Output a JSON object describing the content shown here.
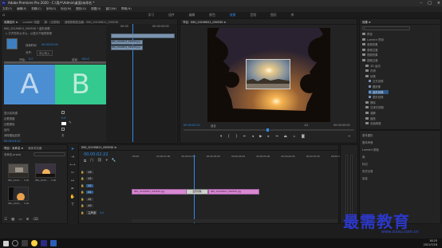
{
  "window": {
    "title": "Adobe Premiere Pro 2020 - C:\\用户\\Admin\\桌面\\未命名 *"
  },
  "menu": [
    "文件(F)",
    "编辑(E)",
    "剪辑(C)",
    "序列(S)",
    "标记(M)",
    "图形(G)",
    "视图(V)",
    "窗口(W)",
    "帮助(H)"
  ],
  "workspaces": [
    "学习",
    "组件",
    "编辑",
    "颜色",
    "效果",
    "音频",
    "图形",
    "库"
  ],
  "workspace_active": "效果",
  "effect_controls": {
    "tabs": [
      "效果控件 ≡",
      "Lumetri 范围",
      "源：(无剪辑)",
      "音频剪辑混合器：IMG_20190811_090530"
    ],
    "header": "IMG_20190811_090530 * 盒形划像",
    "desc": "▷ 打开形状从中心，以显示下面的剪辑",
    "duration_label": "持续时间",
    "duration": "00:00:01:00",
    "align_label": "对齐：",
    "align_value": "中心切入",
    "start_label": "开始：",
    "start_value": "0.0",
    "end_label": "结束：",
    "end_value": "100.0",
    "show_actual": "显示实际源",
    "border_width": "边框宽度",
    "border_width_value": "0.0",
    "border_color": "边框颜色",
    "reverse": "反向",
    "antialias": "消除锯齿品质",
    "antialias_value": "关",
    "thumb_a": "A",
    "thumb_b": "B",
    "time": "00:00:03:22",
    "mini_timecodes": [
      "00:00",
      "00:00:05:00"
    ],
    "clip1": "IMG_20190811_090530.jpg",
    "clip2": "IMG_20190811_090530.jpg"
  },
  "program": {
    "tabs": [
      "节目：IMG_20190811_090530 ≡"
    ],
    "timecode": "00:00:02:22",
    "fit": "适合",
    "zoom": "1/2",
    "duration": "00:00:05:00"
  },
  "effects": {
    "tab": "效果 ≡",
    "items": [
      {
        "label": "预设",
        "indent": 1,
        "type": "folder"
      },
      {
        "label": "Lumetri 预设",
        "indent": 1,
        "type": "folder"
      },
      {
        "label": "音频效果",
        "indent": 1,
        "type": "folder"
      },
      {
        "label": "音频过渡",
        "indent": 1,
        "type": "folder"
      },
      {
        "label": "视频效果",
        "indent": 1,
        "type": "folder"
      },
      {
        "label": "视频过渡",
        "indent": 1,
        "type": "folder"
      },
      {
        "label": "3D 运动",
        "indent": 2,
        "type": "folder"
      },
      {
        "label": "内滑",
        "indent": 2,
        "type": "folder"
      },
      {
        "label": "划像",
        "indent": 2,
        "type": "folder"
      },
      {
        "label": "交叉划像",
        "indent": 3,
        "type": "item"
      },
      {
        "label": "圆划像",
        "indent": 3,
        "type": "item"
      },
      {
        "label": "盒形划像",
        "indent": 3,
        "type": "item",
        "selected": true
      },
      {
        "label": "菱形划像",
        "indent": 3,
        "type": "item"
      },
      {
        "label": "擦除",
        "indent": 2,
        "type": "folder"
      },
      {
        "label": "沉浸式视频",
        "indent": 2,
        "type": "folder"
      },
      {
        "label": "溶解",
        "indent": 2,
        "type": "folder"
      },
      {
        "label": "缩放",
        "indent": 2,
        "type": "folder"
      },
      {
        "label": "页面剥落",
        "indent": 2,
        "type": "folder"
      }
    ]
  },
  "right_lower": [
    "基本图形",
    "基本声音",
    "Lumetri 颜色",
    "库",
    "标记",
    "历史记录",
    "信息"
  ],
  "project": {
    "tabs": [
      "项目：未命名 ≡",
      "媒体浏览器"
    ],
    "name": "未命名.prproj",
    "thumbs": [
      {
        "label": "IMG_2019...",
        "dur": "5:00"
      },
      {
        "label": "IMG_2019...",
        "dur": "5:00"
      },
      {
        "label": "IMG_2019...",
        "dur": "5:00"
      }
    ]
  },
  "timeline": {
    "tab": "IMG_20190811_090530 ≡",
    "timecode": "00:00:02:22",
    "ruler": [
      ":00:00",
      "00:00:01:00",
      "00:00:02:00",
      "00:00:03:00",
      "00:00:04:00",
      "00:00:05:00",
      "00:00:06:00",
      "00:00:07:00",
      "00:00:08:00"
    ],
    "tracks": [
      "V3",
      "V2",
      "V1",
      "A1",
      "A2",
      "A3",
      "主声道"
    ],
    "master_value": "0.0",
    "clip1": "IMG_20190811_090530.jpg",
    "transition": "盒形划像",
    "clip2": "IMG_20190811_090530.jpg"
  },
  "watermark": {
    "text": "最需教育",
    "site": "www.zuixu.com.cn"
  },
  "taskbar": {
    "clock_time": "16:25",
    "clock_date": "2021/7/18"
  }
}
